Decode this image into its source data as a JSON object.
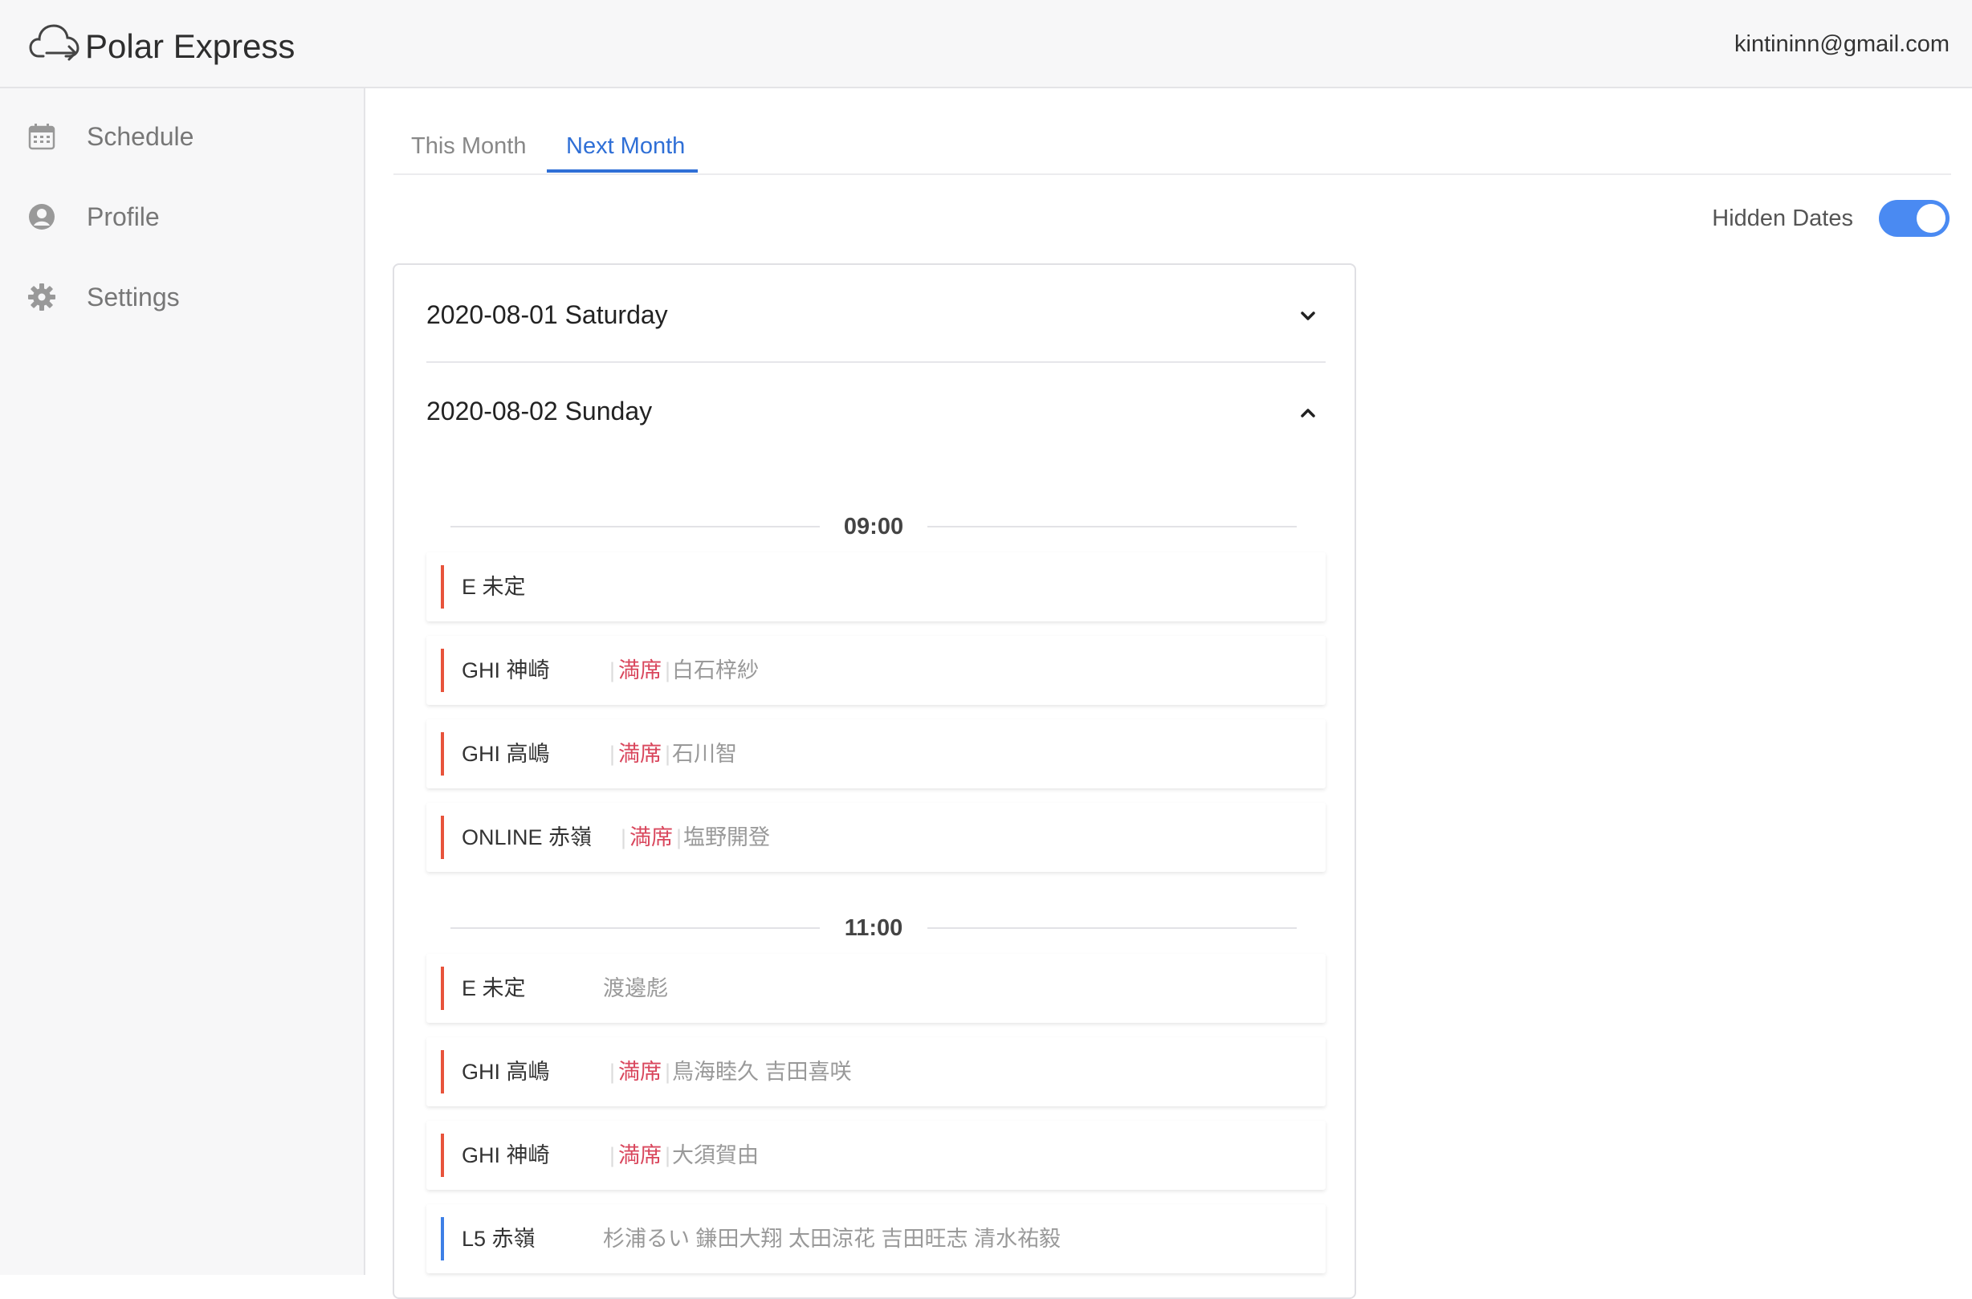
{
  "header": {
    "brand": "Polar Express",
    "user_email": "kintininn@gmail.com"
  },
  "sidebar": {
    "items": [
      {
        "label": "Schedule",
        "icon": "calendar-icon"
      },
      {
        "label": "Profile",
        "icon": "user-circle-icon"
      },
      {
        "label": "Settings",
        "icon": "gear-icon"
      }
    ]
  },
  "tabs": [
    {
      "label": "This Month",
      "active": false
    },
    {
      "label": "Next Month",
      "active": true
    }
  ],
  "hidden_dates": {
    "label": "Hidden Dates",
    "enabled": true
  },
  "days": [
    {
      "title": "2020-08-01 Saturday",
      "expanded": false
    },
    {
      "title": "2020-08-02 Sunday",
      "expanded": true
    }
  ],
  "time_groups": [
    {
      "time": "09:00",
      "slots": [
        {
          "klass": "E  未定",
          "full": "",
          "names": ""
        },
        {
          "klass": "GHI  神崎",
          "full": "満席",
          "names": "白石梓紗"
        },
        {
          "klass": "GHI  高嶋",
          "full": "満席",
          "names": "石川智"
        },
        {
          "klass": "ONLINE  赤嶺",
          "full": "満席",
          "names": "塩野開登"
        }
      ]
    },
    {
      "time": "11:00",
      "slots": [
        {
          "klass": "E  未定",
          "full": "",
          "names": "渡邊彪"
        },
        {
          "klass": "GHI  高嶋",
          "full": "満席",
          "names": "鳥海睦久  吉田喜咲"
        },
        {
          "klass": "GHI  神崎",
          "full": "満席",
          "names": "大須賀由"
        },
        {
          "klass": "L5  赤嶺",
          "full": "",
          "names": "杉浦るい  鎌田大翔  太田涼花  吉田旺志  清水祐毅"
        }
      ]
    }
  ],
  "colors": {
    "accent": "#2f6fd6",
    "toggle_on": "#4a8af2",
    "slot_bar_red": "#e8533b",
    "slot_bar_blue": "#3d7fe6",
    "full_text": "#d9475d"
  }
}
